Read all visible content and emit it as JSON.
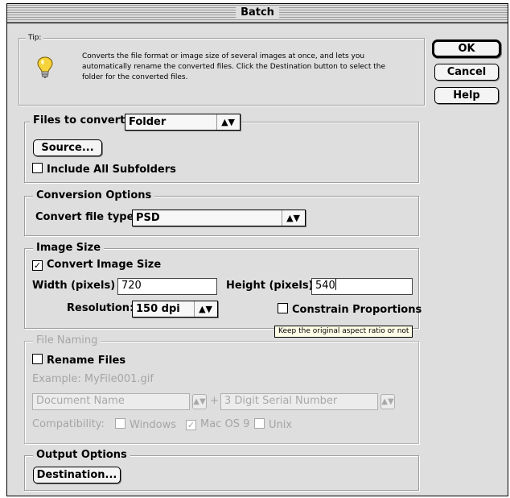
{
  "window": {
    "title": "Batch"
  },
  "tip": {
    "label": "Tip:",
    "icon": "lightbulb-icon",
    "text": "Converts the file format or image size of several images at  once, and lets you automatically rename the converted files. Click the  Destination button to select the folder for the converted files."
  },
  "buttons": {
    "ok": "OK",
    "cancel": "Cancel",
    "help": "Help"
  },
  "files": {
    "label": "Files to convert:",
    "selected": "Folder",
    "source_button": "Source...",
    "include_subfolders": "Include All Subfolders",
    "include_subfolders_checked": false
  },
  "conversion": {
    "title": "Conversion Options",
    "label": "Convert file type:",
    "selected": "PSD"
  },
  "image_size": {
    "title": "Image Size",
    "convert_label": "Convert Image Size",
    "convert_checked": true,
    "width_label": "Width (pixels)",
    "width_value": "720",
    "height_label": "Height (pixels)",
    "height_value": "540",
    "resolution_label": "Resolution:",
    "resolution_value": "150 dpi",
    "constrain_label": "Constrain Proportions",
    "constrain_checked": false,
    "tooltip": "Keep the original aspect ratio or not"
  },
  "naming": {
    "title": "File Naming",
    "rename_label": "Rename Files",
    "rename_checked": false,
    "example": "Example: MyFile001.gif",
    "field1": "Document Name",
    "plus": "+",
    "field2": "3 Digit Serial Number",
    "compat_label": "Compatibility:",
    "windows": "Windows",
    "windows_checked": false,
    "mac": "Mac OS 9",
    "mac_checked": true,
    "unix": "Unix",
    "unix_checked": false
  },
  "output": {
    "title": "Output Options",
    "destination_button": "Destination..."
  }
}
